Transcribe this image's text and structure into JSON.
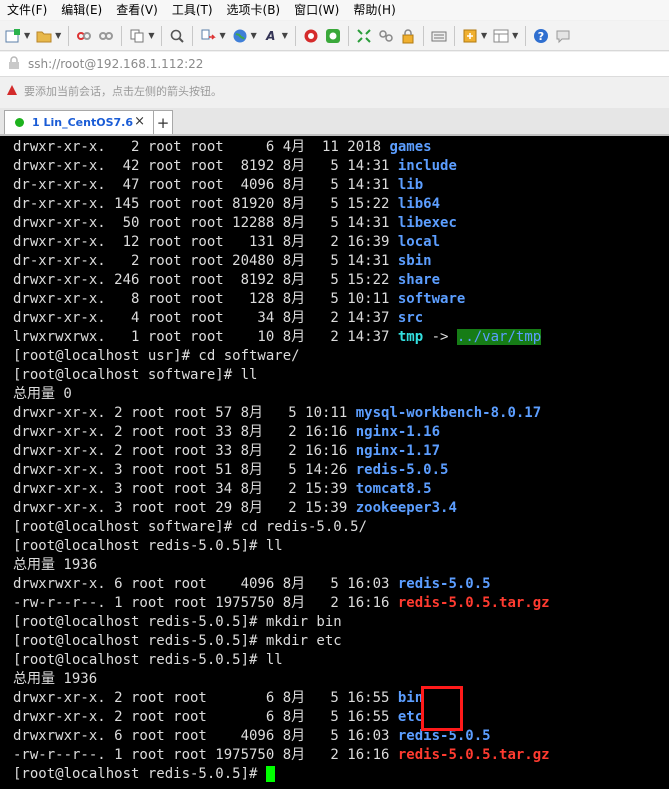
{
  "menu": [
    "文件(F)",
    "编辑(E)",
    "查看(V)",
    "工具(T)",
    "选项卡(B)",
    "窗口(W)",
    "帮助(H)"
  ],
  "address": "ssh://root@192.168.1.112:22",
  "hint": "要添加当前会话，点击左侧的箭头按钮。",
  "tab": {
    "label": "1 Lin_CentOS7.6",
    "close": "×",
    "add": "+"
  },
  "colors": {
    "terminal_bg": "#000000",
    "dir": "#5c9eff",
    "tar": "#ff3b30",
    "link": "#33e0e0",
    "cursor": "#00ff00",
    "highlight": "#ff1a1a"
  },
  "terminal": [
    {
      "prefix": "drwxr-xr-x.   2 root root     6 4月  11 2018 ",
      "name": "games",
      "type": "dir"
    },
    {
      "prefix": "drwxr-xr-x.  42 root root  8192 8月   5 14:31 ",
      "name": "include",
      "type": "dir"
    },
    {
      "prefix": "dr-xr-xr-x.  47 root root  4096 8月   5 14:31 ",
      "name": "lib",
      "type": "dir"
    },
    {
      "prefix": "dr-xr-xr-x. 145 root root 81920 8月   5 15:22 ",
      "name": "lib64",
      "type": "dir"
    },
    {
      "prefix": "drwxr-xr-x.  50 root root 12288 8月   5 14:31 ",
      "name": "libexec",
      "type": "dir"
    },
    {
      "prefix": "drwxr-xr-x.  12 root root   131 8月   2 16:39 ",
      "name": "local",
      "type": "dir"
    },
    {
      "prefix": "dr-xr-xr-x.   2 root root 20480 8月   5 14:31 ",
      "name": "sbin",
      "type": "dir"
    },
    {
      "prefix": "drwxr-xr-x. 246 root root  8192 8月   5 15:22 ",
      "name": "share",
      "type": "dir"
    },
    {
      "prefix": "drwxr-xr-x.   8 root root   128 8月   5 10:11 ",
      "name": "software",
      "type": "dir"
    },
    {
      "prefix": "drwxr-xr-x.   4 root root    34 8月   2 14:37 ",
      "name": "src",
      "type": "dir"
    },
    {
      "prefix": "lrwxrwxrwx.   1 root root    10 8月   2 14:37 ",
      "name": "tmp",
      "type": "link",
      "arrow": " -> ",
      "target": "../var/tmp"
    },
    {
      "prefix": "[root@localhost usr]# cd software/",
      "type": "plain"
    },
    {
      "prefix": "[root@localhost software]# ll",
      "type": "plain"
    },
    {
      "prefix": "总用量 0",
      "type": "plain"
    },
    {
      "prefix": "drwxr-xr-x. 2 root root 57 8月   5 10:11 ",
      "name": "mysql-workbench-8.0.17",
      "type": "dir"
    },
    {
      "prefix": "drwxr-xr-x. 2 root root 33 8月   2 16:16 ",
      "name": "nginx-1.16",
      "type": "dir"
    },
    {
      "prefix": "drwxr-xr-x. 2 root root 33 8月   2 16:16 ",
      "name": "nginx-1.17",
      "type": "dir"
    },
    {
      "prefix": "drwxr-xr-x. 3 root root 51 8月   5 14:26 ",
      "name": "redis-5.0.5",
      "type": "dir"
    },
    {
      "prefix": "drwxr-xr-x. 3 root root 34 8月   2 15:39 ",
      "name": "tomcat8.5",
      "type": "dir"
    },
    {
      "prefix": "drwxr-xr-x. 3 root root 29 8月   2 15:39 ",
      "name": "zookeeper3.4",
      "type": "dir"
    },
    {
      "prefix": "[root@localhost software]# cd redis-5.0.5/",
      "type": "plain"
    },
    {
      "prefix": "[root@localhost redis-5.0.5]# ll",
      "type": "plain"
    },
    {
      "prefix": "总用量 1936",
      "type": "plain"
    },
    {
      "prefix": "drwxrwxr-x. 6 root root    4096 8月   5 16:03 ",
      "name": "redis-5.0.5",
      "type": "dir"
    },
    {
      "prefix": "-rw-r--r--. 1 root root 1975750 8月   2 16:16 ",
      "name": "redis-5.0.5.tar.gz",
      "type": "tar"
    },
    {
      "prefix": "[root@localhost redis-5.0.5]# mkdir bin",
      "type": "plain"
    },
    {
      "prefix": "[root@localhost redis-5.0.5]# mkdir etc",
      "type": "plain"
    },
    {
      "prefix": "[root@localhost redis-5.0.5]# ll",
      "type": "plain"
    },
    {
      "prefix": "总用量 1936",
      "type": "plain"
    },
    {
      "prefix": "drwxr-xr-x. 2 root root       6 8月   5 16:55 ",
      "name": "bin",
      "type": "dir"
    },
    {
      "prefix": "drwxr-xr-x. 2 root root       6 8月   5 16:55 ",
      "name": "etc",
      "type": "dir"
    },
    {
      "prefix": "drwxrwxr-x. 6 root root    4096 8月   5 16:03 ",
      "name": "redis-5.0.5",
      "type": "dir"
    },
    {
      "prefix": "-rw-r--r--. 1 root root 1975750 8月   2 16:16 ",
      "name": "redis-5.0.5.tar.gz",
      "type": "tar"
    },
    {
      "prefix": "[root@localhost redis-5.0.5]# ",
      "type": "prompt"
    }
  ]
}
